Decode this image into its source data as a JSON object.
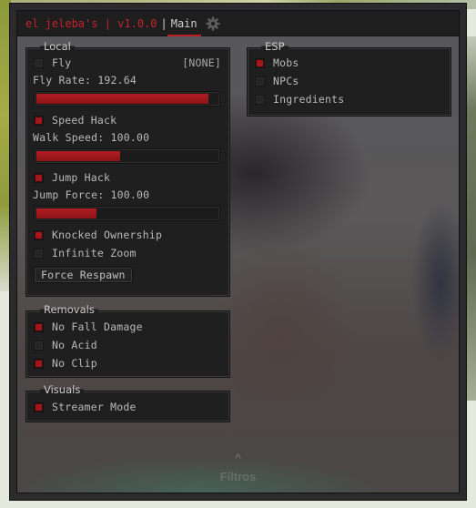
{
  "titlebar": {
    "title": "el jeleba's | v1.0.0",
    "separator": "|",
    "active_tab": "Main",
    "settings_icon": "gear-icon"
  },
  "local": {
    "label": "Local",
    "fly": {
      "label": "Fly",
      "checked": false,
      "keybind": "[NONE]"
    },
    "fly_rate": {
      "label": "Fly Rate: 192.64",
      "value": 192.64,
      "fill_fraction": 0.95
    },
    "speed_hack": {
      "label": "Speed Hack",
      "checked": true
    },
    "walk_speed": {
      "label": "Walk Speed: 100.00",
      "value": 100.0,
      "fill_fraction": 0.46
    },
    "jump_hack": {
      "label": "Jump Hack",
      "checked": true
    },
    "jump_force": {
      "label": "Jump Force: 100.00",
      "value": 100.0,
      "fill_fraction": 0.33
    },
    "knocked_ownership": {
      "label": "Knocked Ownership",
      "checked": true
    },
    "infinite_zoom": {
      "label": "Infinite Zoom",
      "checked": false
    },
    "force_respawn": {
      "label": "Force Respawn"
    }
  },
  "removals": {
    "label": "Removals",
    "items": [
      {
        "label": "No Fall Damage",
        "checked": true
      },
      {
        "label": "No Acid",
        "checked": false
      },
      {
        "label": "No Clip",
        "checked": true
      }
    ]
  },
  "visuals": {
    "label": "Visuals",
    "items": [
      {
        "label": "Streamer Mode",
        "checked": true
      }
    ]
  },
  "esp": {
    "label": "ESP",
    "items": [
      {
        "label": "Mobs",
        "checked": true
      },
      {
        "label": "NPCs",
        "checked": false
      },
      {
        "label": "Ingredients",
        "checked": false
      }
    ]
  },
  "overlay": {
    "chevron": "^",
    "filters_label": "Filtros"
  },
  "colors": {
    "accent": "#b01c22",
    "checked": "#a5161c",
    "title_text": "#c4232a",
    "panel_bg": "#1f1f1f"
  }
}
